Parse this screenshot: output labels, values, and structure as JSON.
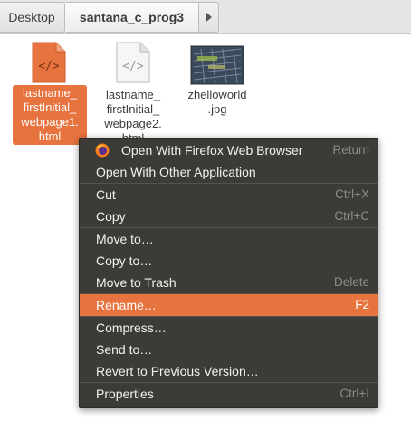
{
  "pathbar": {
    "crumbs": [
      "Desktop",
      "santana_c_prog3"
    ]
  },
  "files": [
    {
      "label": "lastname_\nfirstInitial_\nwebpage1.\nhtml",
      "icon": "html-file-icon",
      "selected": true
    },
    {
      "label": "lastname_\nfirstInitial_\nwebpage2.\nhtml",
      "icon": "html-file-icon",
      "selected": false
    },
    {
      "label": "zhelloworld\n.jpg",
      "icon": "image-thumbnail",
      "selected": false
    }
  ],
  "context_menu": {
    "items": [
      {
        "label": "Open With Firefox Web Browser",
        "shortcut": "Return",
        "icon": "firefox-icon"
      },
      {
        "label": "Open With Other Application",
        "shortcut": ""
      },
      {
        "label": "Cut",
        "shortcut": "Ctrl+X"
      },
      {
        "label": "Copy",
        "shortcut": "Ctrl+C"
      },
      {
        "label": "Move to…",
        "shortcut": ""
      },
      {
        "label": "Copy to…",
        "shortcut": ""
      },
      {
        "label": "Move to Trash",
        "shortcut": "Delete"
      },
      {
        "label": "Rename…",
        "shortcut": "F2",
        "highlighted": true
      },
      {
        "label": "Compress…",
        "shortcut": ""
      },
      {
        "label": "Send to…",
        "shortcut": ""
      },
      {
        "label": "Revert to Previous Version…",
        "shortcut": ""
      },
      {
        "label": "Properties",
        "shortcut": "Ctrl+I"
      }
    ]
  },
  "colors": {
    "accent": "#e7733f",
    "menu_bg": "#3c3b37",
    "menu_text": "#f2f1f0",
    "shortcut_text": "#8e8c87"
  }
}
